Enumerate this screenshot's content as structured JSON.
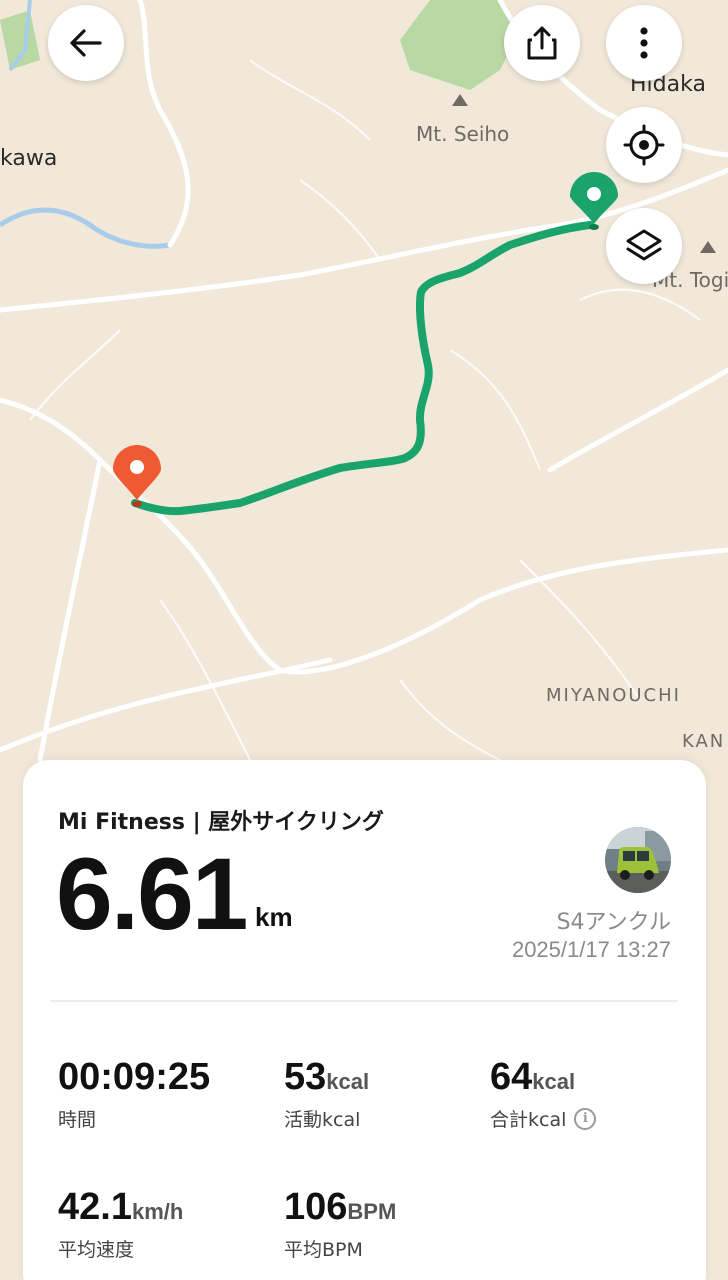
{
  "map": {
    "place_labels": {
      "hidaka": "Hidaka",
      "mt_seiho": "Mt. Seiho",
      "kawa": "kawa",
      "mt_togi": "Mt. Togi",
      "miyanouchi": "MIYANOUCHI",
      "kan": "KAN"
    },
    "route_color": "#1aa36a",
    "start_pin_color": "#1aa36a",
    "end_pin_color": "#f05a33"
  },
  "controls": {
    "back_icon": "arrow-left-icon",
    "share_icon": "share-icon",
    "more_icon": "more-vertical-icon",
    "locate_icon": "locate-icon",
    "layers_icon": "layers-icon"
  },
  "summary": {
    "source": "Mi Fitness | 屋外サイクリング",
    "distance_value": "6.61",
    "distance_unit": "km",
    "device_name": "S4アンクル",
    "datetime": "2025/1/17 13:27"
  },
  "stats": [
    {
      "value": "00:09:25",
      "unit": "",
      "label": "時間"
    },
    {
      "value": "53",
      "unit": "kcal",
      "label": "活動kcal"
    },
    {
      "value": "64",
      "unit": "kcal",
      "label": "合計kcal"
    },
    {
      "value": "42.1",
      "unit": "km/h",
      "label": "平均速度"
    },
    {
      "value": "106",
      "unit": "BPM",
      "label": "平均BPM"
    }
  ]
}
